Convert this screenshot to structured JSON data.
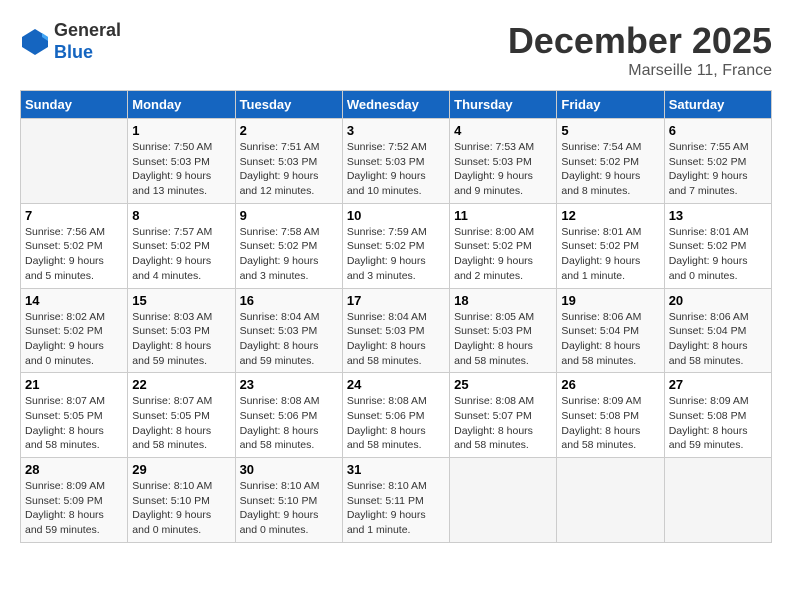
{
  "header": {
    "logo_line1": "General",
    "logo_line2": "Blue",
    "month": "December 2025",
    "location": "Marseille 11, France"
  },
  "weekdays": [
    "Sunday",
    "Monday",
    "Tuesday",
    "Wednesday",
    "Thursday",
    "Friday",
    "Saturday"
  ],
  "weeks": [
    [
      {
        "day": "",
        "info": ""
      },
      {
        "day": "1",
        "info": "Sunrise: 7:50 AM\nSunset: 5:03 PM\nDaylight: 9 hours\nand 13 minutes."
      },
      {
        "day": "2",
        "info": "Sunrise: 7:51 AM\nSunset: 5:03 PM\nDaylight: 9 hours\nand 12 minutes."
      },
      {
        "day": "3",
        "info": "Sunrise: 7:52 AM\nSunset: 5:03 PM\nDaylight: 9 hours\nand 10 minutes."
      },
      {
        "day": "4",
        "info": "Sunrise: 7:53 AM\nSunset: 5:03 PM\nDaylight: 9 hours\nand 9 minutes."
      },
      {
        "day": "5",
        "info": "Sunrise: 7:54 AM\nSunset: 5:02 PM\nDaylight: 9 hours\nand 8 minutes."
      },
      {
        "day": "6",
        "info": "Sunrise: 7:55 AM\nSunset: 5:02 PM\nDaylight: 9 hours\nand 7 minutes."
      }
    ],
    [
      {
        "day": "7",
        "info": "Sunrise: 7:56 AM\nSunset: 5:02 PM\nDaylight: 9 hours\nand 5 minutes."
      },
      {
        "day": "8",
        "info": "Sunrise: 7:57 AM\nSunset: 5:02 PM\nDaylight: 9 hours\nand 4 minutes."
      },
      {
        "day": "9",
        "info": "Sunrise: 7:58 AM\nSunset: 5:02 PM\nDaylight: 9 hours\nand 3 minutes."
      },
      {
        "day": "10",
        "info": "Sunrise: 7:59 AM\nSunset: 5:02 PM\nDaylight: 9 hours\nand 3 minutes."
      },
      {
        "day": "11",
        "info": "Sunrise: 8:00 AM\nSunset: 5:02 PM\nDaylight: 9 hours\nand 2 minutes."
      },
      {
        "day": "12",
        "info": "Sunrise: 8:01 AM\nSunset: 5:02 PM\nDaylight: 9 hours\nand 1 minute."
      },
      {
        "day": "13",
        "info": "Sunrise: 8:01 AM\nSunset: 5:02 PM\nDaylight: 9 hours\nand 0 minutes."
      }
    ],
    [
      {
        "day": "14",
        "info": "Sunrise: 8:02 AM\nSunset: 5:02 PM\nDaylight: 9 hours\nand 0 minutes."
      },
      {
        "day": "15",
        "info": "Sunrise: 8:03 AM\nSunset: 5:03 PM\nDaylight: 8 hours\nand 59 minutes."
      },
      {
        "day": "16",
        "info": "Sunrise: 8:04 AM\nSunset: 5:03 PM\nDaylight: 8 hours\nand 59 minutes."
      },
      {
        "day": "17",
        "info": "Sunrise: 8:04 AM\nSunset: 5:03 PM\nDaylight: 8 hours\nand 58 minutes."
      },
      {
        "day": "18",
        "info": "Sunrise: 8:05 AM\nSunset: 5:03 PM\nDaylight: 8 hours\nand 58 minutes."
      },
      {
        "day": "19",
        "info": "Sunrise: 8:06 AM\nSunset: 5:04 PM\nDaylight: 8 hours\nand 58 minutes."
      },
      {
        "day": "20",
        "info": "Sunrise: 8:06 AM\nSunset: 5:04 PM\nDaylight: 8 hours\nand 58 minutes."
      }
    ],
    [
      {
        "day": "21",
        "info": "Sunrise: 8:07 AM\nSunset: 5:05 PM\nDaylight: 8 hours\nand 58 minutes."
      },
      {
        "day": "22",
        "info": "Sunrise: 8:07 AM\nSunset: 5:05 PM\nDaylight: 8 hours\nand 58 minutes."
      },
      {
        "day": "23",
        "info": "Sunrise: 8:08 AM\nSunset: 5:06 PM\nDaylight: 8 hours\nand 58 minutes."
      },
      {
        "day": "24",
        "info": "Sunrise: 8:08 AM\nSunset: 5:06 PM\nDaylight: 8 hours\nand 58 minutes."
      },
      {
        "day": "25",
        "info": "Sunrise: 8:08 AM\nSunset: 5:07 PM\nDaylight: 8 hours\nand 58 minutes."
      },
      {
        "day": "26",
        "info": "Sunrise: 8:09 AM\nSunset: 5:08 PM\nDaylight: 8 hours\nand 58 minutes."
      },
      {
        "day": "27",
        "info": "Sunrise: 8:09 AM\nSunset: 5:08 PM\nDaylight: 8 hours\nand 59 minutes."
      }
    ],
    [
      {
        "day": "28",
        "info": "Sunrise: 8:09 AM\nSunset: 5:09 PM\nDaylight: 8 hours\nand 59 minutes."
      },
      {
        "day": "29",
        "info": "Sunrise: 8:10 AM\nSunset: 5:10 PM\nDaylight: 9 hours\nand 0 minutes."
      },
      {
        "day": "30",
        "info": "Sunrise: 8:10 AM\nSunset: 5:10 PM\nDaylight: 9 hours\nand 0 minutes."
      },
      {
        "day": "31",
        "info": "Sunrise: 8:10 AM\nSunset: 5:11 PM\nDaylight: 9 hours\nand 1 minute."
      },
      {
        "day": "",
        "info": ""
      },
      {
        "day": "",
        "info": ""
      },
      {
        "day": "",
        "info": ""
      }
    ]
  ]
}
